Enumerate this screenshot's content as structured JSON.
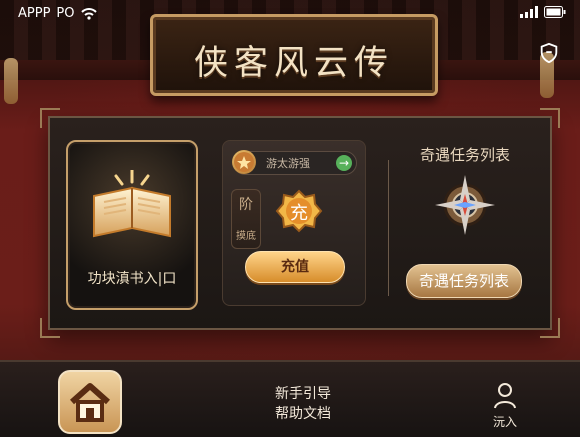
{
  "status_bar": {
    "left_text": "APPP",
    "carrier": "PO",
    "icons": [
      "wifi-icon",
      "signal-icon",
      "battery-icon"
    ]
  },
  "header": {
    "title": "侠客风云传",
    "right_icon": "shield-icon"
  },
  "panel": {
    "book_card": {
      "caption": "功块滇书入|口"
    },
    "middle_card": {
      "search_placeholder": "游太游强",
      "search_icon": "gift-icon",
      "go_icon": "arrow-right-icon",
      "side_tag_top": "阶",
      "side_tag_bottom": "摸底",
      "badge_text": "充",
      "recharge_button": "充值"
    },
    "quest": {
      "title": "奇遇任务列表",
      "button": "奇遇任务列表",
      "compass_icon": "compass-icon"
    }
  },
  "bottom_bar": {
    "home_icon": "house-icon",
    "guide_line1": "新手引导",
    "guide_line2": "帮助文档",
    "profile_icon": "user-icon",
    "profile_label": "沅入"
  },
  "colors": {
    "accent_gold": "#d7a25a",
    "wall_red": "#6b1e19",
    "panel_dark": "#1c1714"
  }
}
